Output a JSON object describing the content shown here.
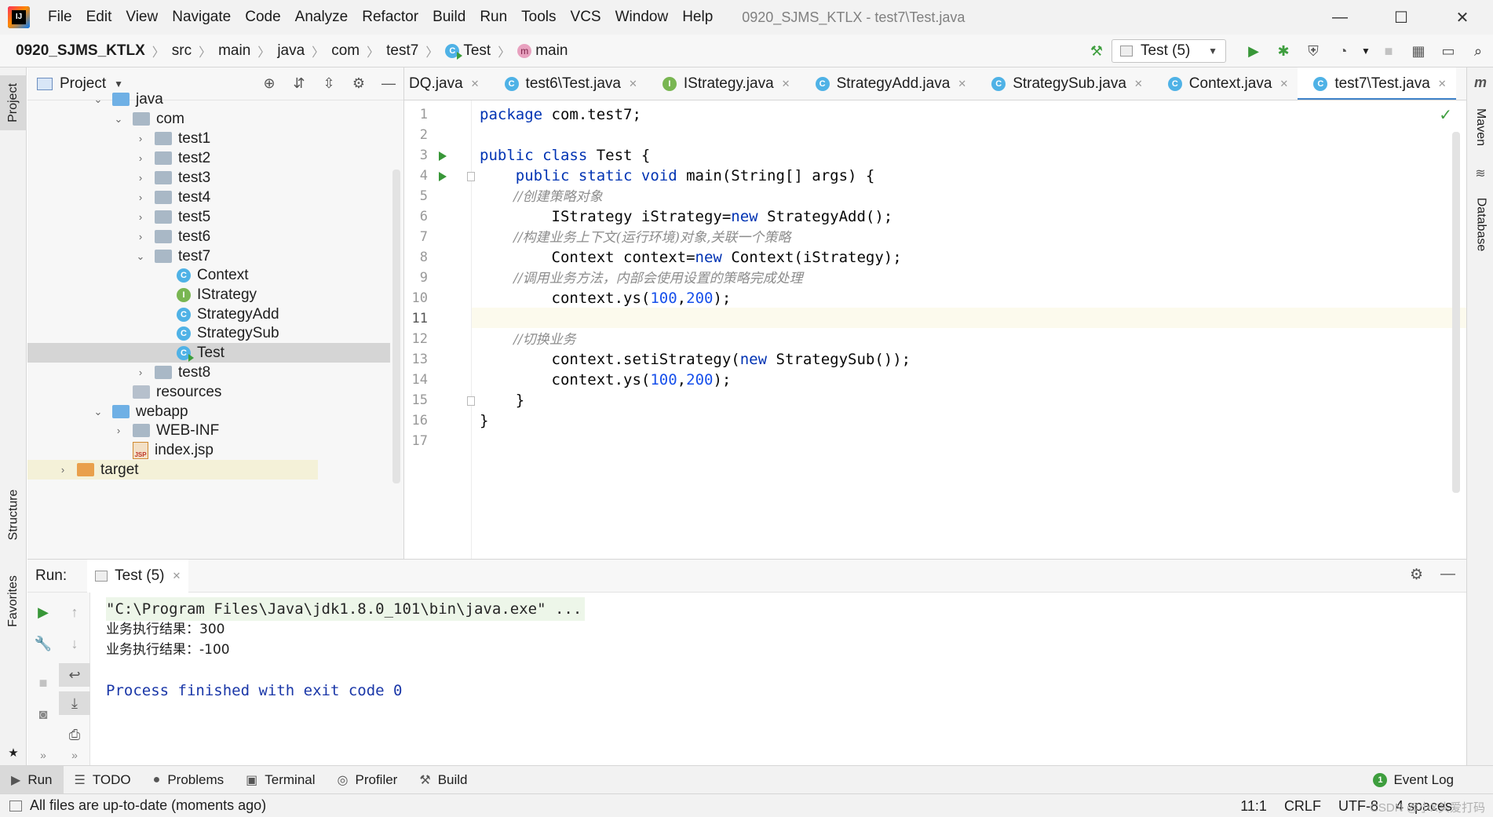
{
  "window": {
    "title": "0920_SJMS_KTLX - test7\\Test.java",
    "minimize": "—",
    "maximize": "☐",
    "close": "✕"
  },
  "menu": [
    "File",
    "Edit",
    "View",
    "Navigate",
    "Code",
    "Analyze",
    "Refactor",
    "Build",
    "Run",
    "Tools",
    "VCS",
    "Window",
    "Help"
  ],
  "breadcrumb": {
    "project": "0920_SJMS_KTLX",
    "parts": [
      "src",
      "main",
      "java",
      "com",
      "test7"
    ],
    "class": "Test",
    "method": "main"
  },
  "run_config": {
    "label": "Test (5)"
  },
  "project_panel": {
    "title": "Project"
  },
  "tree": [
    {
      "label": "java",
      "arrow": "⌄",
      "icon": "folder-blue"
    },
    {
      "label": "com",
      "arrow": "⌄",
      "icon": "folder"
    },
    {
      "label": "test1",
      "arrow": "›",
      "icon": "folder"
    },
    {
      "label": "test2",
      "arrow": "›",
      "icon": "folder"
    },
    {
      "label": "test3",
      "arrow": "›",
      "icon": "folder"
    },
    {
      "label": "test4",
      "arrow": "›",
      "icon": "folder"
    },
    {
      "label": "test5",
      "arrow": "›",
      "icon": "folder"
    },
    {
      "label": "test6",
      "arrow": "›",
      "icon": "folder"
    },
    {
      "label": "test7",
      "arrow": "⌄",
      "icon": "folder"
    },
    {
      "label": "Context",
      "arrow": "",
      "icon": "class"
    },
    {
      "label": "IStrategy",
      "arrow": "",
      "icon": "interface"
    },
    {
      "label": "StrategyAdd",
      "arrow": "",
      "icon": "class"
    },
    {
      "label": "StrategySub",
      "arrow": "",
      "icon": "class"
    },
    {
      "label": "Test",
      "arrow": "",
      "icon": "class-run",
      "selected": true
    },
    {
      "label": "test8",
      "arrow": "›",
      "icon": "folder"
    },
    {
      "label": "resources",
      "arrow": "",
      "icon": "folder-res"
    },
    {
      "label": "webapp",
      "arrow": "⌄",
      "icon": "folder-web"
    },
    {
      "label": "WEB-INF",
      "arrow": "›",
      "icon": "folder"
    },
    {
      "label": "index.jsp",
      "arrow": "",
      "icon": "jsp"
    },
    {
      "label": "target",
      "arrow": "›",
      "icon": "folder-orange"
    }
  ],
  "jsp_badge": "JSP",
  "editor_tabs": [
    {
      "label": "DQ.java",
      "icon": "",
      "active": false
    },
    {
      "label": "test6\\Test.java",
      "icon": "C",
      "active": false
    },
    {
      "label": "IStrategy.java",
      "icon": "I",
      "active": false
    },
    {
      "label": "StrategyAdd.java",
      "icon": "C",
      "active": false
    },
    {
      "label": "StrategySub.java",
      "icon": "C",
      "active": false
    },
    {
      "label": "Context.java",
      "icon": "C",
      "active": false
    },
    {
      "label": "test7\\Test.java",
      "icon": "C",
      "active": true
    }
  ],
  "code": {
    "line_numbers": [
      "1",
      "2",
      "3",
      "4",
      "5",
      "6",
      "7",
      "8",
      "9",
      "10",
      "11",
      "12",
      "13",
      "14",
      "15",
      "16",
      "17"
    ],
    "current_line": "11",
    "lines": [
      [
        {
          "t": "package ",
          "c": "kw"
        },
        {
          "t": "com.test7;",
          "c": ""
        }
      ],
      [],
      [
        {
          "t": "public class ",
          "c": "kw"
        },
        {
          "t": "Test {",
          "c": ""
        }
      ],
      [
        {
          "t": "    public static void ",
          "c": "kw"
        },
        {
          "t": "main(String[] args) {",
          "c": ""
        }
      ],
      [
        {
          "t": "        //创建策略对象",
          "c": "cmt"
        }
      ],
      [
        {
          "t": "        IStrategy iStrategy=",
          "c": ""
        },
        {
          "t": "new ",
          "c": "kw"
        },
        {
          "t": "StrategyAdd();",
          "c": ""
        }
      ],
      [
        {
          "t": "        //构建业务上下文(运行环境)对象,关联一个策略",
          "c": "cmt"
        }
      ],
      [
        {
          "t": "        Context context=",
          "c": ""
        },
        {
          "t": "new ",
          "c": "kw"
        },
        {
          "t": "Context(iStrategy);",
          "c": ""
        }
      ],
      [
        {
          "t": "        //调用业务方法，内部会使用设置的策略完成处理",
          "c": "cmt"
        }
      ],
      [
        {
          "t": "        context.ys(",
          "c": ""
        },
        {
          "t": "100",
          "c": "num"
        },
        {
          "t": ",",
          "c": ""
        },
        {
          "t": "200",
          "c": "num"
        },
        {
          "t": ");",
          "c": ""
        }
      ],
      [],
      [
        {
          "t": "        //切换业务",
          "c": "cmt"
        }
      ],
      [
        {
          "t": "        context.setiStrategy(",
          "c": ""
        },
        {
          "t": "new ",
          "c": "kw"
        },
        {
          "t": "StrategySub());",
          "c": ""
        }
      ],
      [
        {
          "t": "        context.ys(",
          "c": ""
        },
        {
          "t": "100",
          "c": "num"
        },
        {
          "t": ",",
          "c": ""
        },
        {
          "t": "200",
          "c": "num"
        },
        {
          "t": ");",
          "c": ""
        }
      ],
      [
        {
          "t": "    }",
          "c": ""
        }
      ],
      [
        {
          "t": "}",
          "c": ""
        }
      ],
      []
    ]
  },
  "run_panel": {
    "label": "Run:",
    "tab": "Test (5)",
    "console": [
      {
        "text": "\"C:\\Program Files\\Java\\jdk1.8.0_101\\bin\\java.exe\" ...",
        "kind": "cmd"
      },
      {
        "text": "业务执行结果：300",
        "kind": "out"
      },
      {
        "text": "业务执行结果：-100",
        "kind": "out"
      },
      {
        "text": "",
        "kind": "out"
      },
      {
        "text": "Process finished with exit code 0",
        "kind": "fin"
      }
    ]
  },
  "left_stripe": {
    "project": "Project",
    "structure": "Structure",
    "favorites": "Favorites"
  },
  "right_stripe": {
    "maven": "Maven",
    "database": "Database"
  },
  "bottom_tabs": [
    {
      "label": "Run",
      "icon": "▶",
      "active": true
    },
    {
      "label": "TODO",
      "icon": "☰",
      "active": false
    },
    {
      "label": "Problems",
      "icon": "●",
      "active": false
    },
    {
      "label": "Terminal",
      "icon": "▣",
      "active": false
    },
    {
      "label": "Profiler",
      "icon": "◎",
      "active": false
    },
    {
      "label": "Build",
      "icon": "⚒",
      "active": false
    }
  ],
  "event_log": {
    "label": "Event Log",
    "count": "1"
  },
  "status": {
    "message": "All files are up-to-date (moments ago)",
    "position": "11:1",
    "line_sep": "CRLF",
    "encoding": "UTF-8",
    "indent": "4 spaces",
    "watermark": "CSDN @小X头爱打码"
  },
  "colors": {
    "keyword": "#0033b3",
    "number": "#1750eb",
    "comment": "#8c8c8c",
    "run_green": "#389738",
    "tab_underline": "#4083c9"
  }
}
